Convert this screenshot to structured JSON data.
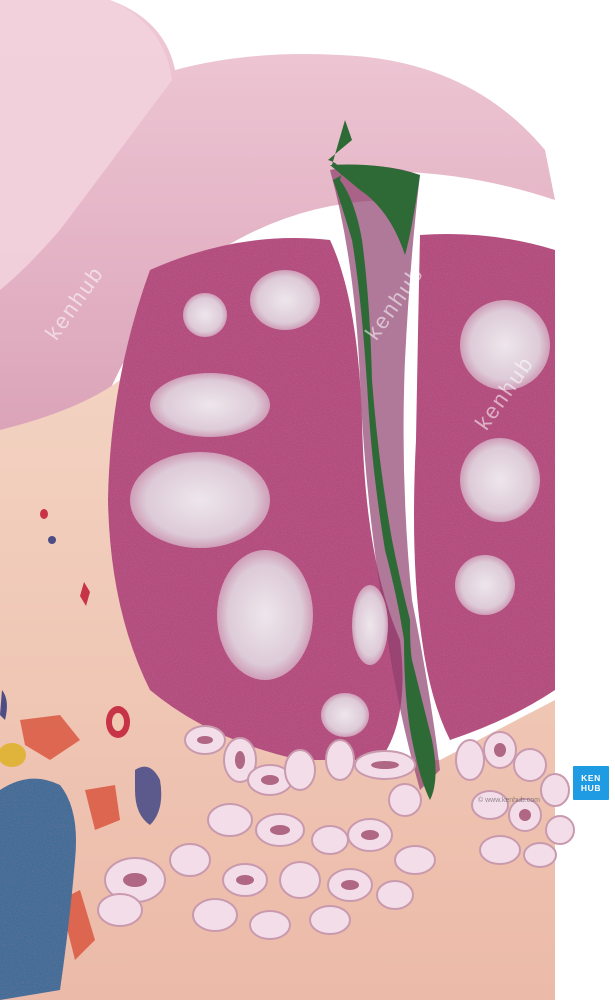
{
  "image": {
    "subject": "medical illustration of a tonsil cross-section with crypt",
    "colors": {
      "mucosa": "#d9a0b4",
      "lymphoid_tissue": "#b64f7e",
      "germinal_center": "#e8dde6",
      "crypt_highlight": "#2e6a35",
      "connective_tissue": "#f1c9b3",
      "gland": "#f3dde8",
      "vein": "#3f6e97"
    }
  },
  "watermark": {
    "brand": "kenhub",
    "badge_line1": "KEN",
    "badge_line2": "HUB",
    "small_text": "© www.kenhub.com"
  }
}
